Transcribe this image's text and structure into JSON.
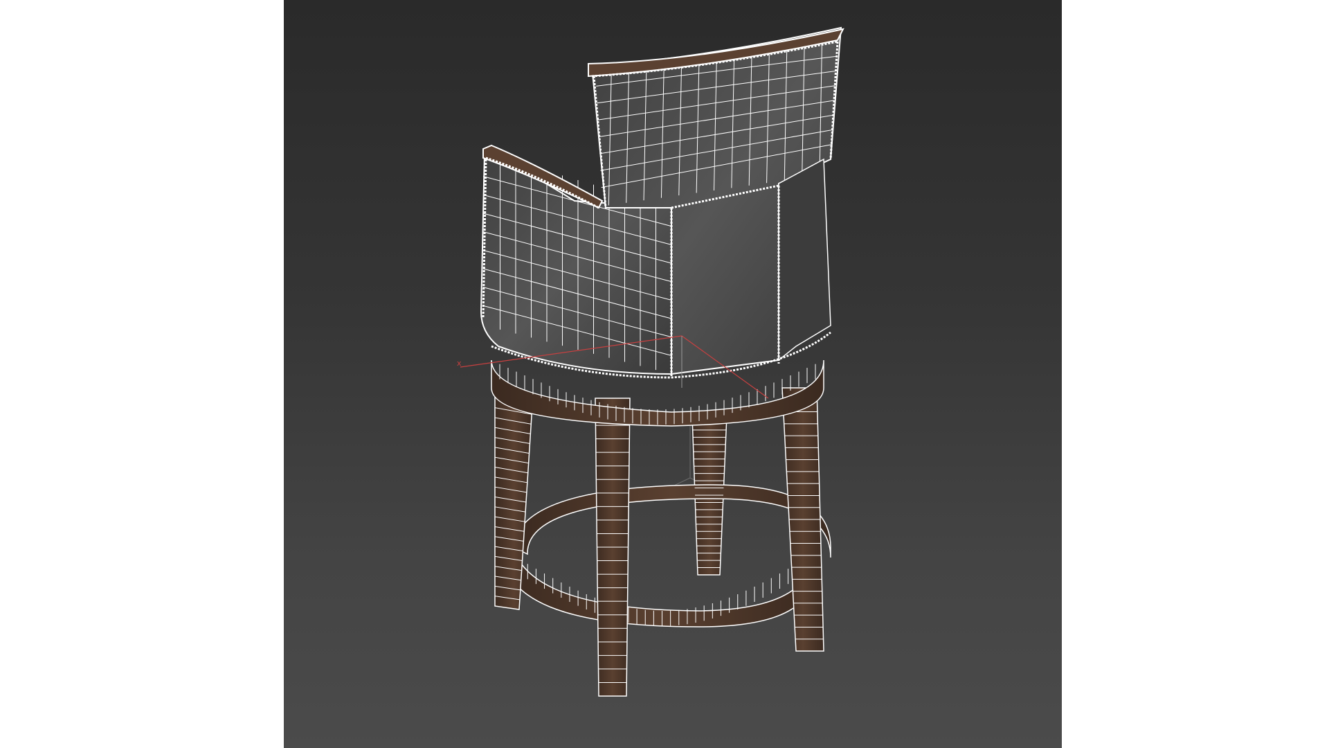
{
  "viewport": {
    "type": "3d-wireframe-render",
    "subject": "bar-stool",
    "background_top": "#2a2a2a",
    "background_bottom": "#4b4b4b",
    "wire_color": "#ffffff",
    "wood_color": "#4a3327",
    "fabric_color": "#4e4e4e"
  },
  "gizmo": {
    "x_label": "x",
    "x_axis_color": "#c94040",
    "pivot_color": "#9a9a9a"
  }
}
